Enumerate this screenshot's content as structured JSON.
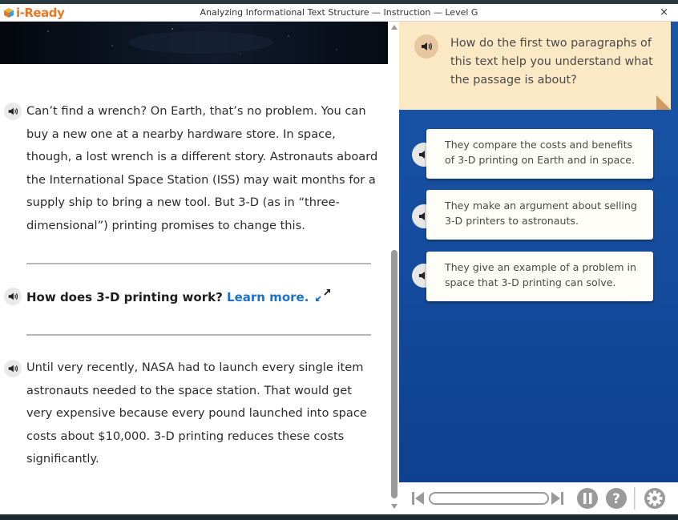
{
  "app": {
    "logo_text": "i-Ready",
    "lesson_title": "Analyzing Informational Text Structure — Instruction — Level G",
    "close_label": "×"
  },
  "passage": {
    "paragraph_1": "Can’t find a wrench? On Earth, that’s no problem. You can buy a new one at a nearby hardware store. In space, though, a lost wrench is a different story. Astronauts aboard the International Space Station (ISS) may wait months for a supply ship to bring a new tool. But 3-D (as in “three-dimensional”) printing promises to change this.",
    "sidebar_prompt": "How does 3-D printing work?",
    "learn_more": "Learn more.",
    "paragraph_2": "Until very recently, NASA had to launch every single item astronauts needed to the space station. That would get very expensive because every pound launched into space costs about $10,000. 3-D printing reduces these costs significantly."
  },
  "question": {
    "text": "How do the first two paragraphs of this text help you understand what the passage is about?"
  },
  "options": [
    {
      "text": "They compare the costs and benefits of 3-D printing on Earth and in space."
    },
    {
      "text": "They make an argument about selling 3-D printers to astronauts."
    },
    {
      "text": "They give an example of a problem in space that 3-D printing can solve."
    }
  ],
  "colors": {
    "accent_orange": "#e87722",
    "link_blue": "#1a73c8",
    "panel_blue": "#1b55a8",
    "question_bg": "#fbe8c4",
    "controls_gray": "#9a9a9a"
  },
  "icons": {
    "audio": "speaker-icon",
    "expand": "expand-arrows-icon",
    "pause": "pause-icon",
    "help": "help-icon",
    "settings": "gear-icon",
    "rewind": "skip-back-icon",
    "forward": "skip-forward-icon"
  }
}
